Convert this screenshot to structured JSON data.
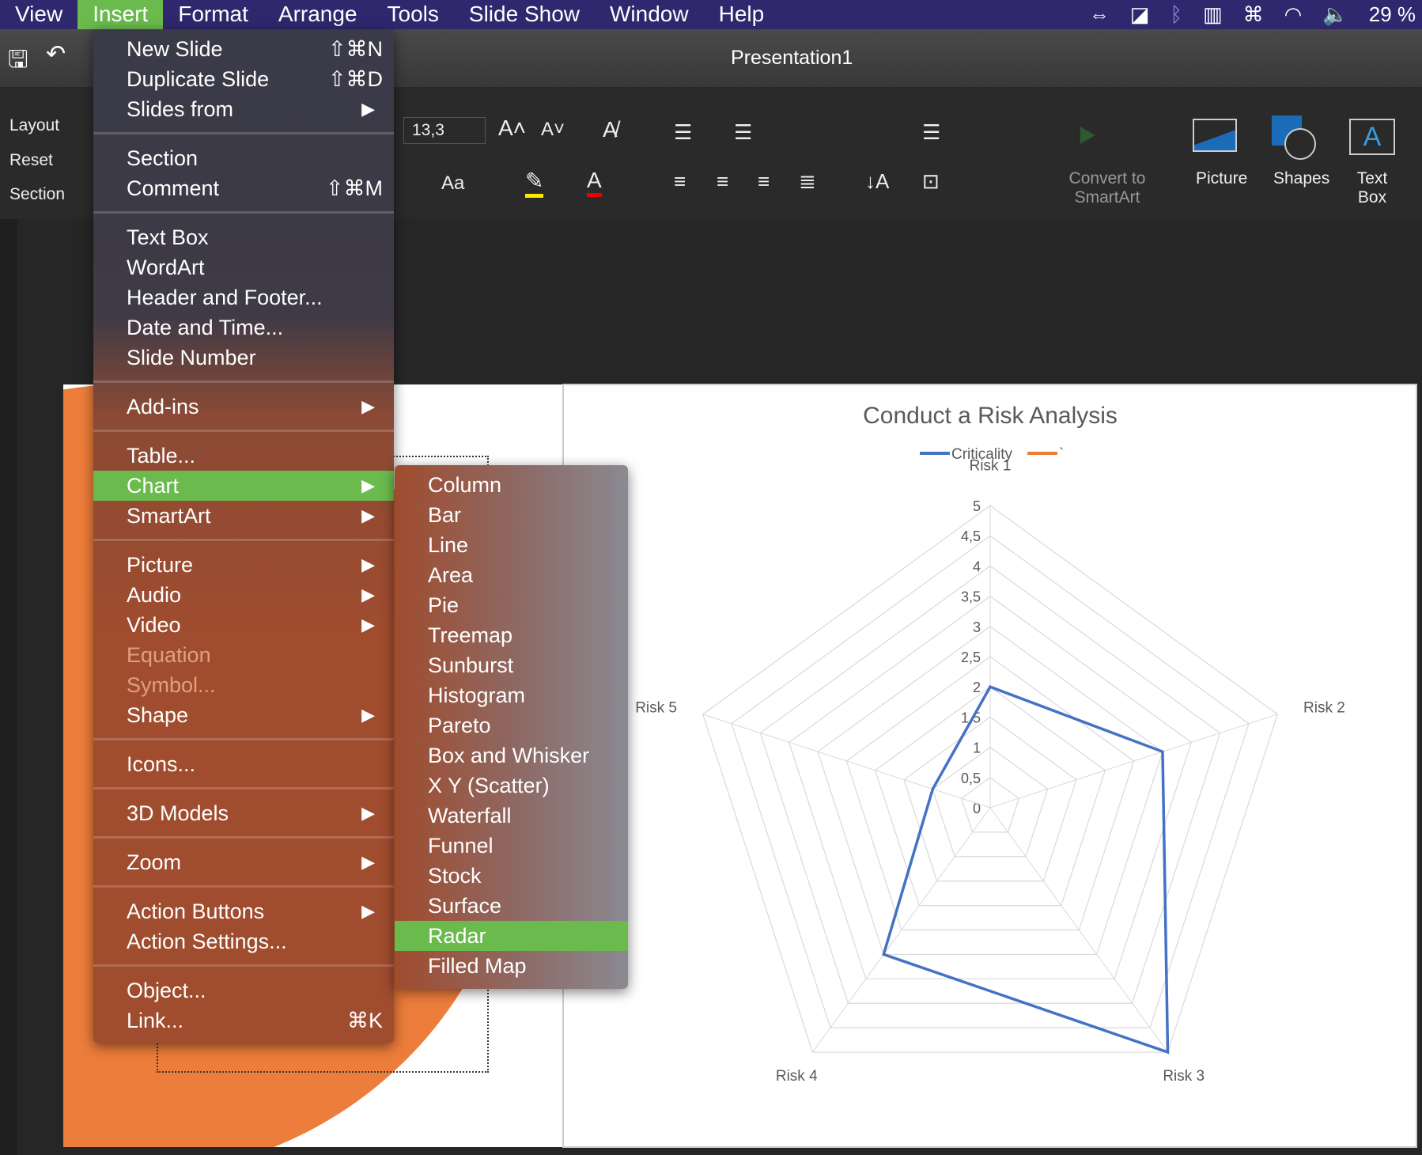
{
  "menubar": {
    "items": [
      "View",
      "Insert",
      "Format",
      "Arrange",
      "Tools",
      "Slide Show",
      "Window",
      "Help"
    ],
    "active": "Insert",
    "battery": "29 %"
  },
  "window": {
    "title": "Presentation1"
  },
  "ribbon": {
    "layout": "Layout",
    "reset": "Reset",
    "section": "Section",
    "font_size": "13,3",
    "aa": "Aa",
    "convert": "Convert to SmartArt",
    "picture": "Picture",
    "shapes": "Shapes",
    "textbox": "Text Box"
  },
  "insert_menu": [
    {
      "label": "New Slide",
      "shortcut": "⇧⌘N"
    },
    {
      "label": "Duplicate Slide",
      "shortcut": "⇧⌘D"
    },
    {
      "label": "Slides from",
      "submenu": true
    },
    {
      "sep": true
    },
    {
      "label": "Section"
    },
    {
      "label": "Comment",
      "shortcut": "⇧⌘M"
    },
    {
      "sep": true
    },
    {
      "label": "Text Box"
    },
    {
      "label": "WordArt"
    },
    {
      "label": "Header and Footer..."
    },
    {
      "label": "Date and Time..."
    },
    {
      "label": "Slide Number"
    },
    {
      "sep": true
    },
    {
      "label": "Add-ins",
      "submenu": true
    },
    {
      "sep": true
    },
    {
      "label": "Table..."
    },
    {
      "label": "Chart",
      "submenu": true,
      "highlighted": true
    },
    {
      "label": "SmartArt",
      "submenu": true
    },
    {
      "sep": true
    },
    {
      "label": "Picture",
      "submenu": true
    },
    {
      "label": "Audio",
      "submenu": true
    },
    {
      "label": "Video",
      "submenu": true
    },
    {
      "label": "Equation",
      "disabled": true
    },
    {
      "label": "Symbol...",
      "disabled": true
    },
    {
      "label": "Shape",
      "submenu": true
    },
    {
      "sep": true
    },
    {
      "label": "Icons..."
    },
    {
      "sep": true
    },
    {
      "label": "3D Models",
      "submenu": true
    },
    {
      "sep": true
    },
    {
      "label": "Zoom",
      "submenu": true
    },
    {
      "sep": true
    },
    {
      "label": "Action Buttons",
      "submenu": true
    },
    {
      "label": "Action Settings..."
    },
    {
      "sep": true
    },
    {
      "label": "Object..."
    },
    {
      "label": "Link...",
      "shortcut": "⌘K"
    }
  ],
  "chart_submenu": {
    "items": [
      "Column",
      "Bar",
      "Line",
      "Area",
      "Pie",
      "Treemap",
      "Sunburst",
      "Histogram",
      "Pareto",
      "Box and Whisker",
      "X Y (Scatter)",
      "Waterfall",
      "Funnel",
      "Stock",
      "Surface",
      "Radar",
      "Filled Map"
    ],
    "highlighted": "Radar"
  },
  "chart_data": {
    "type": "radar",
    "title": "Conduct a Risk Analysis",
    "categories": [
      "Risk  1",
      "Risk 2",
      "Risk 3",
      "Risk 4",
      "Risk 5"
    ],
    "series": [
      {
        "name": "Criticality",
        "values": [
          2,
          3,
          5,
          3,
          1
        ],
        "color": "#4472c4"
      },
      {
        "name": "`",
        "values": [],
        "color": "#ed7d31"
      }
    ],
    "rlim": [
      0,
      5
    ],
    "ticks": [
      "0",
      "0,5",
      "1",
      "1,5",
      "2",
      "2,5",
      "3",
      "3,5",
      "4",
      "4,5",
      "5"
    ],
    "legend": "top"
  },
  "colors": {
    "menubar": "#30286e",
    "highlight": "#6aba4e",
    "slide_orange": "#ed7d3a"
  }
}
